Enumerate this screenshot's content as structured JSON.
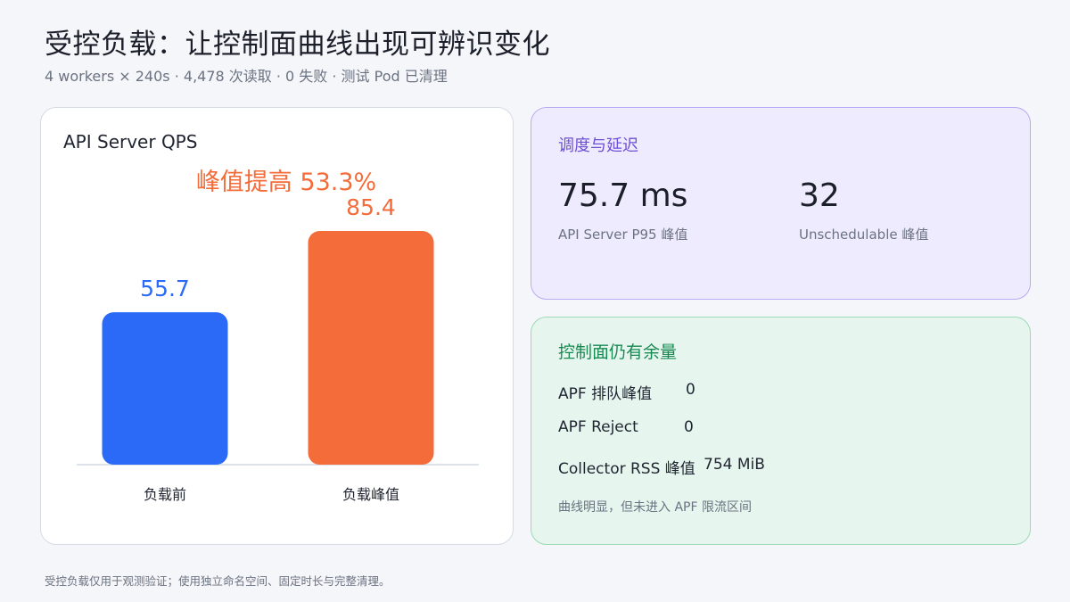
{
  "header": {
    "title": "受控负载：让控制面曲线出现可辨识变化",
    "subtitle": "4 workers × 240s · 4,478 次读取 · 0 失败 · 测试 Pod 已清理"
  },
  "chart_card": {
    "title": "API Server QPS",
    "annotation": "峰值提高 53.3%"
  },
  "chart_data": {
    "type": "bar",
    "title": "API Server QPS",
    "categories": [
      "负载前",
      "负载峰值"
    ],
    "values": [
      55.7,
      85.4
    ],
    "value_labels": [
      "55.7",
      "85.4"
    ],
    "colors": [
      "#2a6af6",
      "#f36c3a"
    ],
    "annotation": "峰值提高 53.3%",
    "ylim": [
      0,
      90
    ],
    "grid": false
  },
  "latency_card": {
    "heading": "调度与延迟",
    "metrics": [
      {
        "value": "75.7 ms",
        "label": "API Server P95 峰值"
      },
      {
        "value": "32",
        "label": "Unschedulable 峰值"
      }
    ]
  },
  "capacity_card": {
    "heading": "控制面仍有余量",
    "rows": [
      {
        "key": "APF 排队峰值",
        "value": "0"
      },
      {
        "key": "APF Reject",
        "value": "0"
      },
      {
        "key": "Collector RSS 峰值",
        "value": "754 MiB"
      }
    ],
    "note": "曲线明显，但未进入 APF 限流区间"
  },
  "footer": {
    "note": "受控负载仅用于观测验证；使用独立命名空间、固定时长与完整清理。"
  },
  "colors": {
    "before": "#2a6af6",
    "peak": "#f36c3a",
    "latency_accent": "#6d4fd6",
    "capacity_accent": "#178a52"
  }
}
